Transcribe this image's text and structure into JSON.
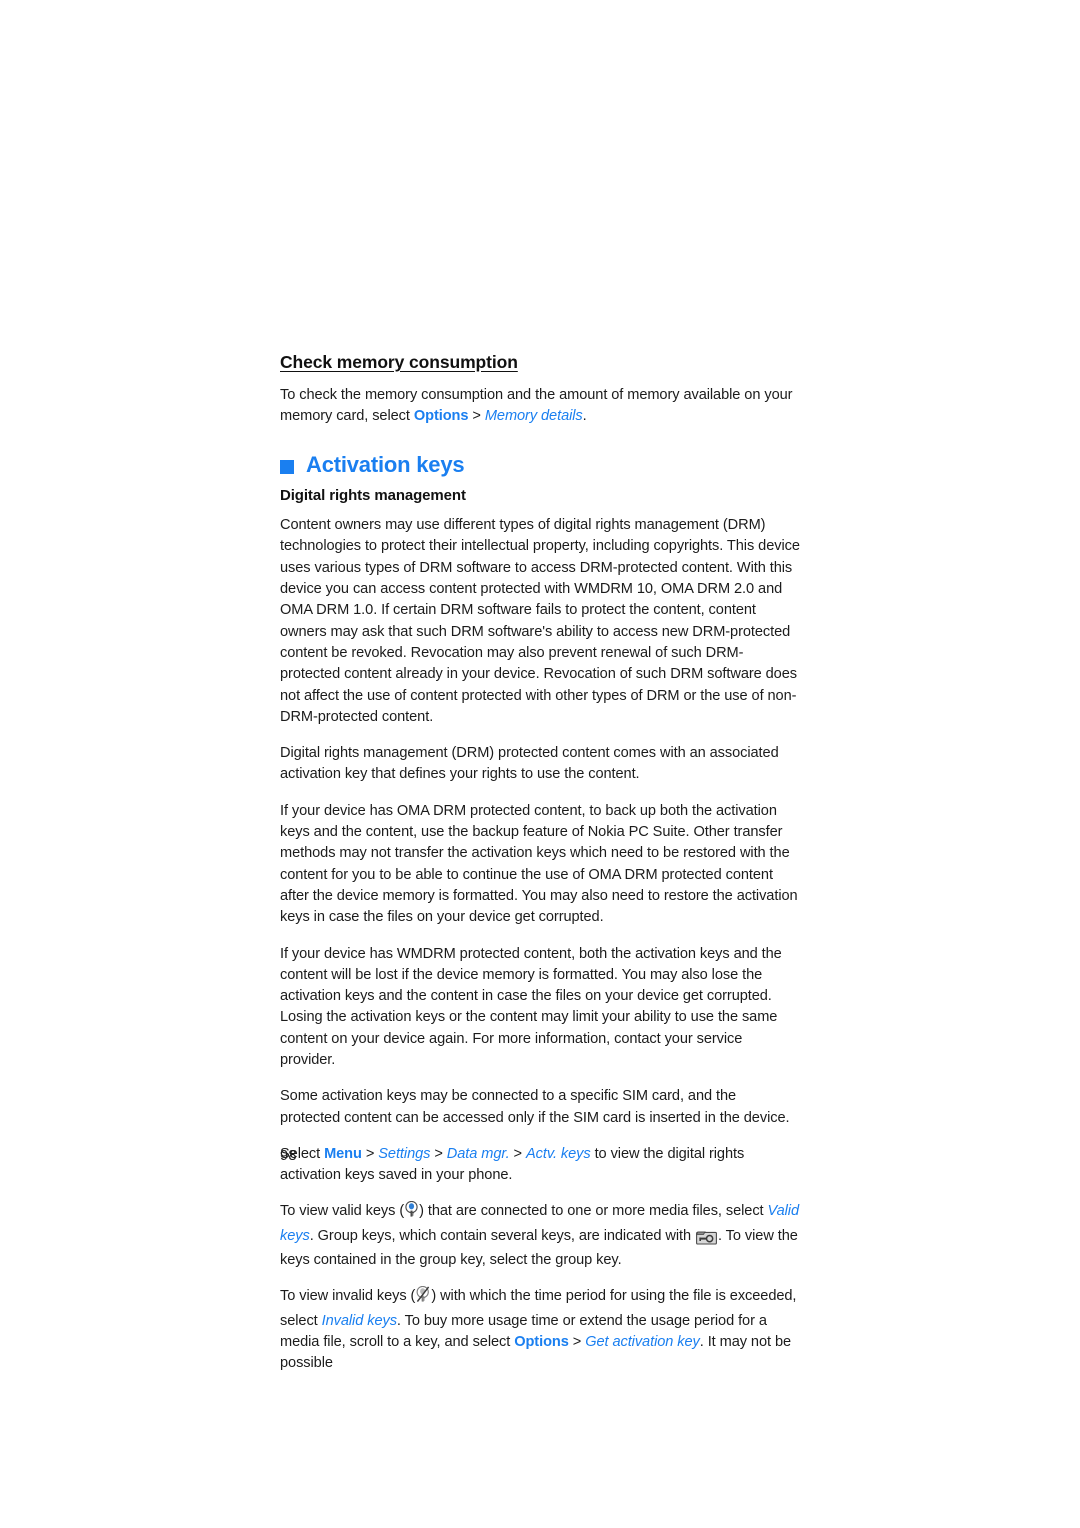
{
  "document": {
    "page_number": "98",
    "accent_color": "#1a7ff0",
    "text_color": "#1c1c1c"
  },
  "sections": {
    "check_memory": {
      "heading": "Check memory consumption",
      "paragraph_prefix": "To check the memory consumption and the amount of memory available on your memory card, select ",
      "link_options": "Options",
      "separator": " > ",
      "link_memory_details": "Memory details",
      "paragraph_suffix": "."
    },
    "activation_keys": {
      "heading": "Activation keys",
      "bullet_icon": "square-bullet-icon",
      "sub_heading": "Digital rights management",
      "paragraphs": [
        "Content owners may use different types of digital rights management (DRM) technologies to protect their intellectual property, including copyrights. This device uses various types of DRM software to access DRM-protected content. With this device you can access content protected with WMDRM 10, OMA DRM 2.0 and OMA DRM 1.0. If certain DRM software fails to protect the content, content owners may ask that such DRM software's ability to access new DRM-protected content be revoked. Revocation may also prevent renewal of such DRM-protected content already in your device. Revocation of such DRM software does not affect the use of content protected with other types of DRM or the use of non-DRM-protected content.",
        "Digital rights management (DRM) protected content comes with an associated activation key that defines your rights to use the content.",
        "If your device has OMA DRM protected content, to back up both the activation keys and the content, use the backup feature of Nokia PC Suite. Other transfer methods may not transfer the activation keys which need to be restored with the content for you to be able to continue the use of OMA DRM protected content after the device memory is formatted. You may also need to restore the activation keys in case the files on your device get corrupted.",
        "If your device has WMDRM protected content, both the activation keys and the content will be lost if the device memory is formatted. You may also lose the activation keys and the content in case the files on your device get corrupted. Losing the activation keys or the content may limit your ability to use the same content on your device again. For more information, contact your service provider.",
        "Some activation keys may be connected to a specific SIM card, and the protected content can be accessed only if the SIM card is inserted in the device."
      ],
      "menu_path": {
        "prefix": "Select ",
        "item_menu": "Menu",
        "sep1": " > ",
        "item_settings": "Settings",
        "sep2": " > ",
        "item_data_mgr": "Data mgr.",
        "sep3": " > ",
        "item_actv_keys": "Actv. keys",
        "suffix": " to view the digital rights activation keys saved in your phone."
      },
      "valid_keys_para": {
        "part1": "To view valid keys (",
        "icon_valid": "valid-key-icon",
        "part2": ") that are connected to one or more media files, select ",
        "link_valid_keys": "Valid keys",
        "part3": ". Group keys, which contain several keys, are indicated with ",
        "icon_group": "group-key-icon",
        "part4": ". To view the keys contained in the group key, select the group key."
      },
      "invalid_keys_para": {
        "part1": "To view invalid keys (",
        "icon_invalid": "invalid-key-icon",
        "part2": ") with which the time period for using the file is exceeded, select ",
        "link_invalid_keys": "Invalid keys",
        "part3": ". To buy more usage time or extend the usage period for a media file, scroll to a key, and select ",
        "link_options": "Options",
        "sep": " > ",
        "link_get_activation_key": "Get activation key",
        "part4": ". It may not be possible"
      }
    }
  }
}
